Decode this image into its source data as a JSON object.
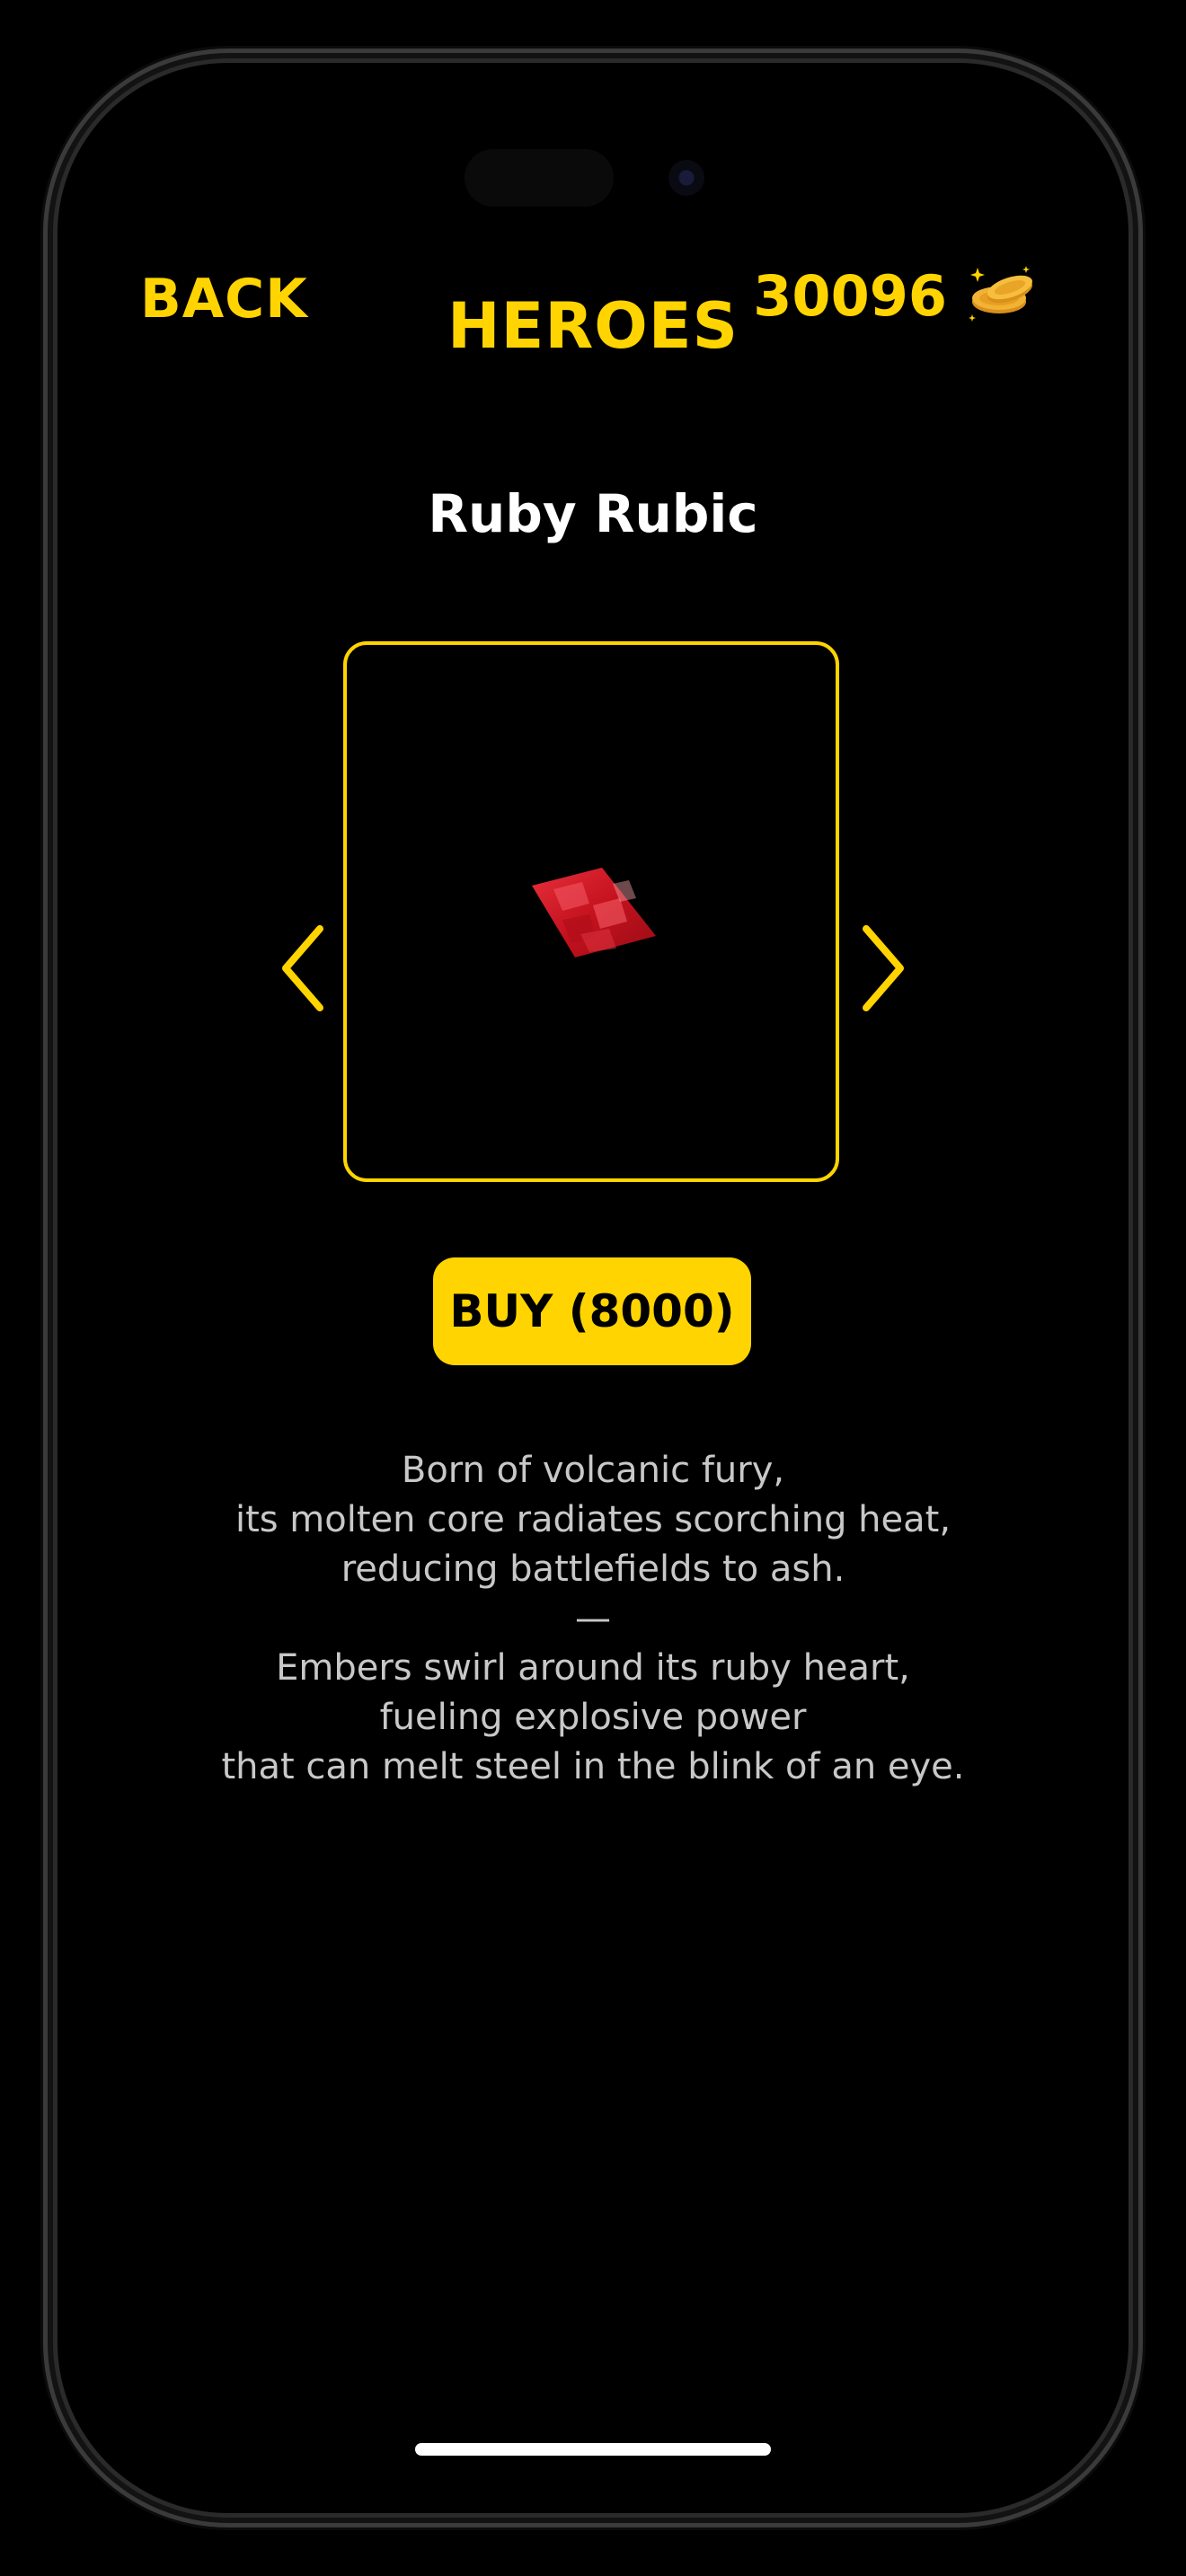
{
  "header": {
    "back_label": "BACK",
    "title": "HEROES",
    "coin_balance": "30096",
    "coin_icon": "coins-icon"
  },
  "hero": {
    "name": "Ruby Rubic",
    "image_icon": "ruby-gem-icon",
    "prev_icon": "chevron-left-icon",
    "next_icon": "chevron-right-icon"
  },
  "buy": {
    "label": "BUY (8000)"
  },
  "description": {
    "lines": [
      "Born of volcanic fury,",
      "its molten core radiates scorching heat,",
      "reducing battlefields to ash.",
      "—",
      "Embers swirl around its ruby heart,",
      "fueling explosive power",
      "that can melt steel in the blink of an eye."
    ]
  },
  "colors": {
    "accent": "#FFD400",
    "background": "#000000",
    "text": "#FFFFFF",
    "muted_text": "#C8C8C8",
    "gem": "#D41A2A"
  }
}
